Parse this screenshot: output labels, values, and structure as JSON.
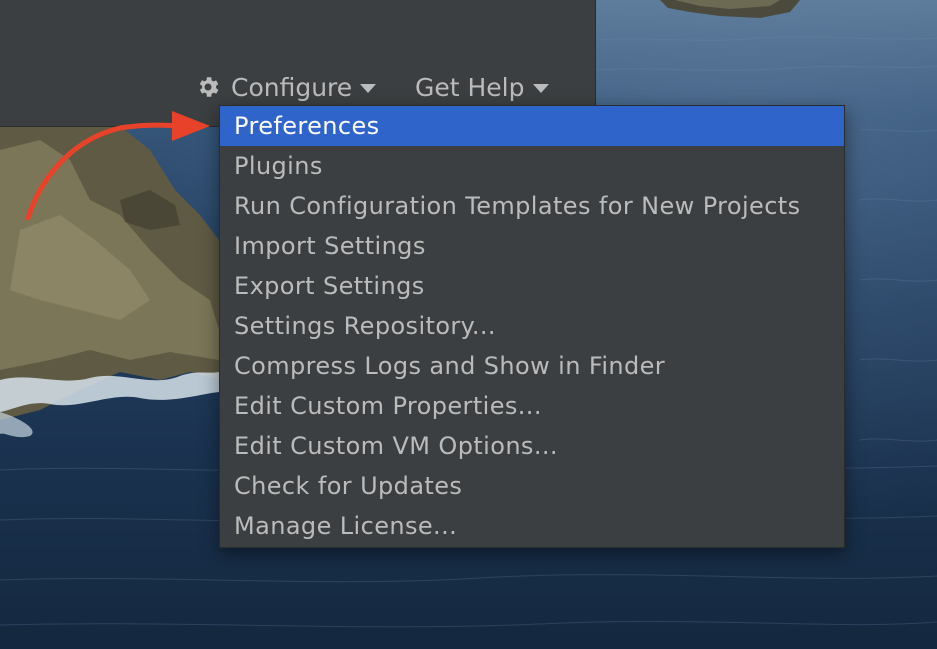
{
  "toolbar": {
    "configure_label": "Configure",
    "get_help_label": "Get Help",
    "icons": {
      "configure": "gear-icon",
      "dropdown": "caret-down-icon"
    }
  },
  "configure_menu": {
    "selected_index": 0,
    "items": [
      {
        "label": "Preferences"
      },
      {
        "label": "Plugins"
      },
      {
        "label": "Run Configuration Templates for New Projects"
      },
      {
        "label": "Import Settings"
      },
      {
        "label": "Export Settings"
      },
      {
        "label": "Settings Repository..."
      },
      {
        "label": "Compress Logs and Show in Finder"
      },
      {
        "label": "Edit Custom Properties..."
      },
      {
        "label": "Edit Custom VM Options..."
      },
      {
        "label": "Check for Updates"
      },
      {
        "label": "Manage License..."
      }
    ]
  },
  "colors": {
    "panel_bg": "#3c3f41",
    "menu_text": "#bbbbbb",
    "selection": "#2f65ca",
    "annotation_arrow": "#e8432a"
  }
}
